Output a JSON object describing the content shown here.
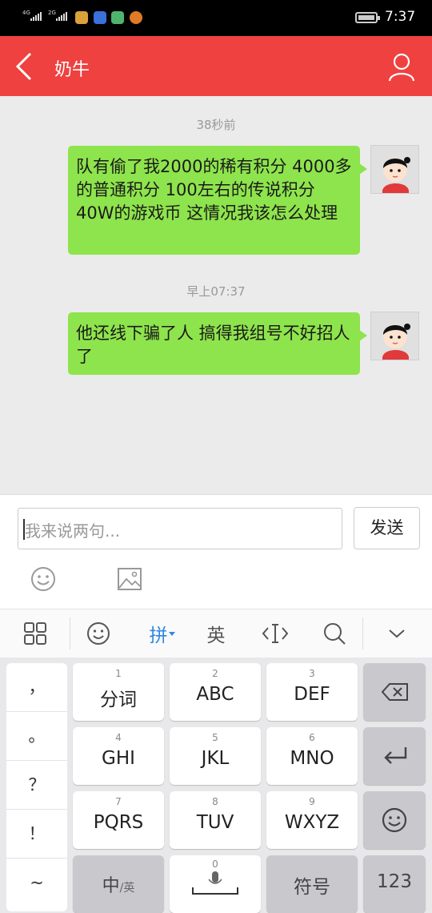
{
  "status_bar": {
    "signal1": "4G",
    "signal2": "2G",
    "time": "7:37"
  },
  "header": {
    "title": "奶牛",
    "back_icon": "chevron-left-icon",
    "user_icon": "user-icon"
  },
  "messages": [
    {
      "timestamp": "38秒前",
      "text": "队有偷了我2000的稀有积分 4000多的普通积分 100左右的传说积分 40W的游戏币 这情况我该怎么处理"
    },
    {
      "timestamp": "早上07:37",
      "text": "他还线下骗了人 搞得我组号不好招人了"
    }
  ],
  "composer": {
    "placeholder": "我来说两句...",
    "send_label": "发送"
  },
  "keyboard_toolbar": {
    "pinyin": "拼",
    "english": "英"
  },
  "keyboard": {
    "punctuation": [
      "，",
      "。",
      "？",
      "！",
      "~"
    ],
    "keys": [
      {
        "num": "1",
        "label": "分词"
      },
      {
        "num": "2",
        "label": "ABC"
      },
      {
        "num": "3",
        "label": "DEF"
      },
      {
        "num": "4",
        "label": "GHI"
      },
      {
        "num": "5",
        "label": "JKL"
      },
      {
        "num": "6",
        "label": "MNO"
      },
      {
        "num": "7",
        "label": "PQRS"
      },
      {
        "num": "8",
        "label": "TUV"
      },
      {
        "num": "9",
        "label": "WXYZ"
      }
    ],
    "zh_key": "中",
    "zh_sub": "/英",
    "space_num": "0",
    "symbol_key": "符号",
    "num_key": "123"
  },
  "colors": {
    "header": "#ef4140",
    "bubble": "#8ee44c",
    "accent_blue": "#2f86e6"
  }
}
